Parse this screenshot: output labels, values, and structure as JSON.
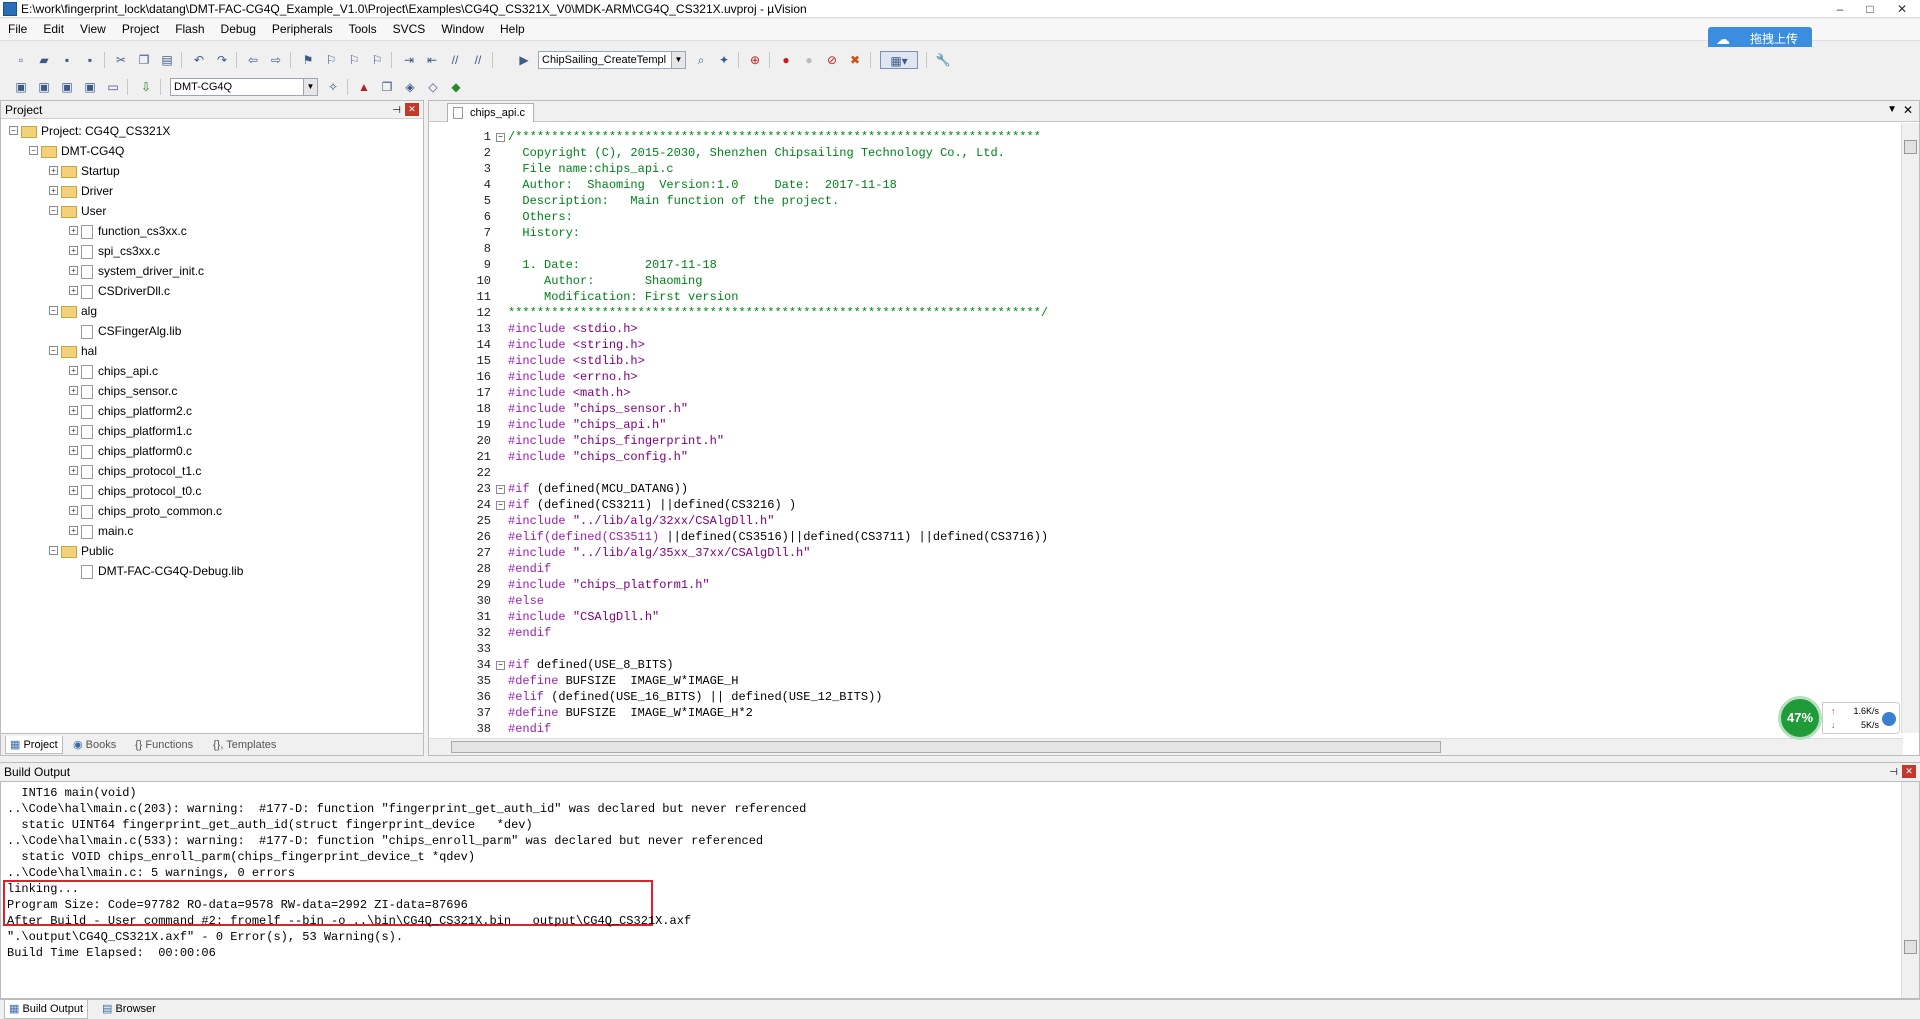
{
  "window": {
    "title": "E:\\work\\fingerprint_lock\\datang\\DMT-FAC-CG4Q_Example_V1.0\\Project\\Examples\\CG4Q_CS321X_V0\\MDK-ARM\\CG4Q_CS321X.uvproj - µVision",
    "minimize": "–",
    "maximize": "□",
    "close": "✕"
  },
  "menu": [
    "File",
    "Edit",
    "View",
    "Project",
    "Flash",
    "Debug",
    "Peripherals",
    "Tools",
    "SVCS",
    "Window",
    "Help"
  ],
  "upload_button": "拖拽上传",
  "toolbar": {
    "find_combo": "ChipSailing_CreateTempl",
    "target_combo": "DMT-CG4Q"
  },
  "project_panel": {
    "title": "Project",
    "tree": [
      {
        "label": "Project: CG4Q_CS321X",
        "kind": "root",
        "level": 0,
        "toggle": "−"
      },
      {
        "label": "DMT-CG4Q",
        "kind": "folder",
        "level": 1,
        "toggle": "−"
      },
      {
        "label": "Startup",
        "kind": "folder",
        "level": 2,
        "toggle": "+"
      },
      {
        "label": "Driver",
        "kind": "folder",
        "level": 2,
        "toggle": "+"
      },
      {
        "label": "User",
        "kind": "folder",
        "level": 2,
        "toggle": "−"
      },
      {
        "label": "function_cs3xx.c",
        "kind": "file",
        "level": 3,
        "toggle": "+"
      },
      {
        "label": "spi_cs3xx.c",
        "kind": "file",
        "level": 3,
        "toggle": "+"
      },
      {
        "label": "system_driver_init.c",
        "kind": "file",
        "level": 3,
        "toggle": "+"
      },
      {
        "label": "CSDriverDll.c",
        "kind": "file",
        "level": 3,
        "toggle": "+"
      },
      {
        "label": "alg",
        "kind": "folder",
        "level": 2,
        "toggle": "−"
      },
      {
        "label": "CSFingerAlg.lib",
        "kind": "file",
        "level": 3,
        "toggle": ""
      },
      {
        "label": "hal",
        "kind": "folder",
        "level": 2,
        "toggle": "−"
      },
      {
        "label": "chips_api.c",
        "kind": "file",
        "level": 3,
        "toggle": "+"
      },
      {
        "label": "chips_sensor.c",
        "kind": "file",
        "level": 3,
        "toggle": "+"
      },
      {
        "label": "chips_platform2.c",
        "kind": "file",
        "level": 3,
        "toggle": "+"
      },
      {
        "label": "chips_platform1.c",
        "kind": "file",
        "level": 3,
        "toggle": "+"
      },
      {
        "label": "chips_platform0.c",
        "kind": "file",
        "level": 3,
        "toggle": "+"
      },
      {
        "label": "chips_protocol_t1.c",
        "kind": "file",
        "level": 3,
        "toggle": "+"
      },
      {
        "label": "chips_protocol_t0.c",
        "kind": "file",
        "level": 3,
        "toggle": "+"
      },
      {
        "label": "chips_proto_common.c",
        "kind": "file",
        "level": 3,
        "toggle": "+"
      },
      {
        "label": "main.c",
        "kind": "file",
        "level": 3,
        "toggle": "+"
      },
      {
        "label": "Public",
        "kind": "folder",
        "level": 2,
        "toggle": "−"
      },
      {
        "label": "DMT-FAC-CG4Q-Debug.lib",
        "kind": "file",
        "level": 3,
        "toggle": ""
      }
    ],
    "tabs": [
      "Project",
      "Books",
      "{} Functions",
      "{}, Templates"
    ]
  },
  "editor": {
    "tab": "chips_api.c",
    "lines": [
      {
        "n": "1",
        "fold": "−",
        "segs": [
          {
            "c": "cm",
            "t": "/*************************************************************************"
          }
        ]
      },
      {
        "n": "2",
        "fold": "",
        "segs": [
          {
            "c": "cm",
            "t": "  Copyright (C), 2015-2030, Shenzhen Chipsailing Technology Co., Ltd."
          }
        ]
      },
      {
        "n": "3",
        "fold": "",
        "segs": [
          {
            "c": "cm",
            "t": "  File name:chips_api.c"
          }
        ]
      },
      {
        "n": "4",
        "fold": "",
        "segs": [
          {
            "c": "cm",
            "t": "  Author:  Shaoming  Version:1.0     Date:  2017-11-18"
          }
        ]
      },
      {
        "n": "5",
        "fold": "",
        "segs": [
          {
            "c": "cm",
            "t": "  Description:   Main function of the project."
          }
        ]
      },
      {
        "n": "6",
        "fold": "",
        "segs": [
          {
            "c": "cm",
            "t": "  Others:"
          }
        ]
      },
      {
        "n": "7",
        "fold": "",
        "segs": [
          {
            "c": "cm",
            "t": "  History:"
          }
        ]
      },
      {
        "n": "8",
        "fold": "",
        "segs": [
          {
            "c": "cm",
            "t": ""
          }
        ]
      },
      {
        "n": "9",
        "fold": "",
        "segs": [
          {
            "c": "cm",
            "t": "  1. Date:         2017-11-18"
          }
        ]
      },
      {
        "n": "10",
        "fold": "",
        "segs": [
          {
            "c": "cm",
            "t": "     Author:       Shaoming"
          }
        ]
      },
      {
        "n": "11",
        "fold": "",
        "segs": [
          {
            "c": "cm",
            "t": "     Modification: First version"
          }
        ]
      },
      {
        "n": "12",
        "fold": "",
        "segs": [
          {
            "c": "cm",
            "t": "**************************************************************************/"
          }
        ]
      },
      {
        "n": "13",
        "fold": "",
        "segs": [
          {
            "c": "pp",
            "t": "#include "
          },
          {
            "c": "str",
            "t": "<stdio.h>"
          }
        ]
      },
      {
        "n": "14",
        "fold": "",
        "segs": [
          {
            "c": "pp",
            "t": "#include "
          },
          {
            "c": "str",
            "t": "<string.h>"
          }
        ]
      },
      {
        "n": "15",
        "fold": "",
        "segs": [
          {
            "c": "pp",
            "t": "#include "
          },
          {
            "c": "str",
            "t": "<stdlib.h>"
          }
        ]
      },
      {
        "n": "16",
        "fold": "",
        "segs": [
          {
            "c": "pp",
            "t": "#include "
          },
          {
            "c": "str",
            "t": "<errno.h>"
          }
        ]
      },
      {
        "n": "17",
        "fold": "",
        "segs": [
          {
            "c": "pp",
            "t": "#include "
          },
          {
            "c": "str",
            "t": "<math.h>"
          }
        ]
      },
      {
        "n": "18",
        "fold": "",
        "segs": [
          {
            "c": "pp",
            "t": "#include "
          },
          {
            "c": "str",
            "t": "\"chips_sensor.h\""
          }
        ]
      },
      {
        "n": "19",
        "fold": "",
        "segs": [
          {
            "c": "pp",
            "t": "#include "
          },
          {
            "c": "str",
            "t": "\"chips_api.h\""
          }
        ]
      },
      {
        "n": "20",
        "fold": "",
        "segs": [
          {
            "c": "pp",
            "t": "#include "
          },
          {
            "c": "str",
            "t": "\"chips_fingerprint.h\""
          }
        ]
      },
      {
        "n": "21",
        "fold": "",
        "segs": [
          {
            "c": "pp",
            "t": "#include "
          },
          {
            "c": "str",
            "t": "\"chips_config.h\""
          }
        ]
      },
      {
        "n": "22",
        "fold": "",
        "segs": [
          {
            "c": "nm",
            "t": ""
          }
        ]
      },
      {
        "n": "23",
        "fold": "−",
        "segs": [
          {
            "c": "pp",
            "t": "#if "
          },
          {
            "c": "nm",
            "t": "(defined(MCU_DATANG))"
          }
        ]
      },
      {
        "n": "24",
        "fold": "−",
        "segs": [
          {
            "c": "pp",
            "t": "#if "
          },
          {
            "c": "nm",
            "t": "(defined(CS3211) ||defined(CS3216) )"
          }
        ]
      },
      {
        "n": "25",
        "fold": "",
        "segs": [
          {
            "c": "pp",
            "t": "#include "
          },
          {
            "c": "str",
            "t": "\"../lib/alg/32xx/CSAlgDll.h\""
          }
        ]
      },
      {
        "n": "26",
        "fold": "",
        "segs": [
          {
            "c": "pp",
            "t": "#elif(defined(CS3511) "
          },
          {
            "c": "nm",
            "t": "||defined(CS3516)||defined(CS3711) ||defined(CS3716))"
          }
        ]
      },
      {
        "n": "27",
        "fold": "",
        "segs": [
          {
            "c": "pp",
            "t": "#include "
          },
          {
            "c": "str",
            "t": "\"../lib/alg/35xx_37xx/CSAlgDll.h\""
          }
        ]
      },
      {
        "n": "28",
        "fold": "",
        "segs": [
          {
            "c": "pp",
            "t": "#endif"
          }
        ]
      },
      {
        "n": "29",
        "fold": "",
        "segs": [
          {
            "c": "pp",
            "t": "#include "
          },
          {
            "c": "str",
            "t": "\"chips_platform1.h\""
          }
        ]
      },
      {
        "n": "30",
        "fold": "",
        "segs": [
          {
            "c": "pp",
            "t": "#else"
          }
        ]
      },
      {
        "n": "31",
        "fold": "",
        "segs": [
          {
            "c": "pp",
            "t": "#include "
          },
          {
            "c": "str",
            "t": "\"CSAlgDll.h\""
          }
        ]
      },
      {
        "n": "32",
        "fold": "",
        "segs": [
          {
            "c": "pp",
            "t": "#endif"
          }
        ]
      },
      {
        "n": "33",
        "fold": "",
        "segs": [
          {
            "c": "nm",
            "t": ""
          }
        ]
      },
      {
        "n": "34",
        "fold": "−",
        "segs": [
          {
            "c": "pp",
            "t": "#if "
          },
          {
            "c": "nm",
            "t": "defined(USE_8_BITS)"
          }
        ]
      },
      {
        "n": "35",
        "fold": "",
        "segs": [
          {
            "c": "pp",
            "t": "#define "
          },
          {
            "c": "nm",
            "t": "BUFSIZE  IMAGE_W*IMAGE_H"
          }
        ]
      },
      {
        "n": "36",
        "fold": "",
        "segs": [
          {
            "c": "pp",
            "t": "#elif "
          },
          {
            "c": "nm",
            "t": "(defined(USE_16_BITS) || defined(USE_12_BITS))"
          }
        ]
      },
      {
        "n": "37",
        "fold": "",
        "segs": [
          {
            "c": "pp",
            "t": "#define "
          },
          {
            "c": "nm",
            "t": "BUFSIZE  IMAGE_W*IMAGE_H*2"
          }
        ]
      },
      {
        "n": "38",
        "fold": "",
        "segs": [
          {
            "c": "pp",
            "t": "#endif"
          }
        ]
      }
    ]
  },
  "build_output": {
    "title": "Build Output",
    "lines": [
      "  INT16 main(void)",
      "..\\Code\\hal\\main.c(203): warning:  #177-D: function \"fingerprint_get_auth_id\" was declared but never referenced",
      "  static UINT64 fingerprint_get_auth_id(struct fingerprint_device   *dev)",
      "..\\Code\\hal\\main.c(533): warning:  #177-D: function \"chips_enroll_parm\" was declared but never referenced",
      "  static VOID chips_enroll_parm(chips_fingerprint_device_t *qdev)",
      "..\\Code\\hal\\main.c: 5 warnings, 0 errors",
      "linking...",
      "Program Size: Code=97782 RO-data=9578 RW-data=2992 ZI-data=87696",
      "After Build - User command #2: fromelf --bin -o ..\\bin\\CG4Q_CS321X.bin   output\\CG4Q_CS321X.axf",
      "\".\\output\\CG4Q_CS321X.axf\" - 0 Error(s), 53 Warning(s).",
      "Build Time Elapsed:  00:00:06"
    ],
    "tabs": [
      "Build Output",
      "Browser"
    ]
  },
  "net_widget": {
    "percent": "47%",
    "up": "1.6K/s",
    "down": "5K/s"
  }
}
